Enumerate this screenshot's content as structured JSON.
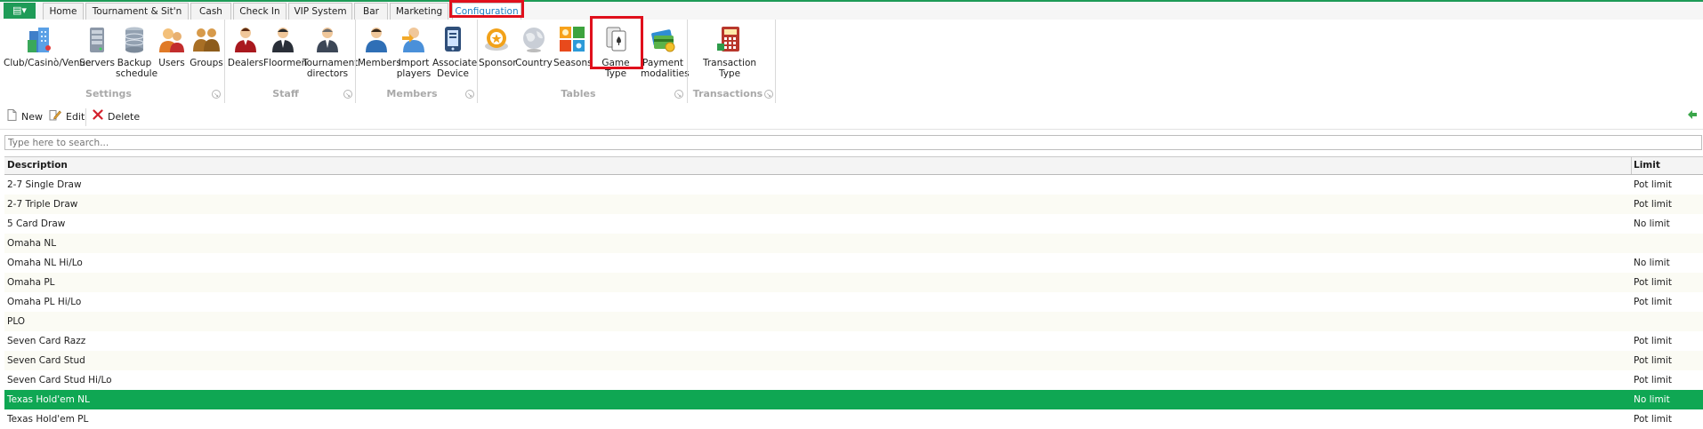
{
  "tabs": [
    {
      "label": "Home"
    },
    {
      "label": "Tournament & Sit'n Go"
    },
    {
      "label": "Cash"
    },
    {
      "label": "Check In"
    },
    {
      "label": "VIP System"
    },
    {
      "label": "Bar"
    },
    {
      "label": "Marketing"
    },
    {
      "label": "Configuration"
    }
  ],
  "ribbon": {
    "buttons": [
      {
        "label": "Club/Casinò/Venue",
        "icon": "building-icon"
      },
      {
        "label": "Servers",
        "icon": "server-icon"
      },
      {
        "label": "Backup\nschedule",
        "icon": "database-icon"
      },
      {
        "label": "Users",
        "icon": "users-icon"
      },
      {
        "label": "Groups",
        "icon": "groups-icon"
      },
      {
        "label": "Dealers",
        "icon": "dealer-icon"
      },
      {
        "label": "Floormen",
        "icon": "floorman-icon"
      },
      {
        "label": "Tournament\ndirectors",
        "icon": "director-icon"
      },
      {
        "label": "Members",
        "icon": "member-icon"
      },
      {
        "label": "Import\nplayers",
        "icon": "import-players-icon"
      },
      {
        "label": "Associate\nDevice",
        "icon": "device-icon"
      },
      {
        "label": "Sponsor",
        "icon": "sponsor-icon"
      },
      {
        "label": "Country",
        "icon": "globe-icon"
      },
      {
        "label": "Seasons",
        "icon": "seasons-icon"
      },
      {
        "label": "Game Type",
        "icon": "game-type-icon"
      },
      {
        "label": "Payment\nmodalities",
        "icon": "payment-icon"
      },
      {
        "label": "Transaction\nType",
        "icon": "calculator-icon"
      }
    ],
    "groups": [
      {
        "label": "Settings"
      },
      {
        "label": "Staff"
      },
      {
        "label": "Members"
      },
      {
        "label": "Tables"
      },
      {
        "label": "Transactions"
      }
    ]
  },
  "toolbar": {
    "new_label": "New",
    "edit_label": "Edit",
    "delete_label": "Delete"
  },
  "search": {
    "placeholder": "Type here to search..."
  },
  "grid": {
    "columns": [
      "Description",
      "Limit"
    ],
    "rows": [
      {
        "description": "2-7 Single Draw",
        "limit": "Pot limit"
      },
      {
        "description": "2-7 Triple Draw",
        "limit": "Pot limit"
      },
      {
        "description": "5 Card Draw",
        "limit": "No limit"
      },
      {
        "description": "Omaha NL",
        "limit": ""
      },
      {
        "description": "Omaha NL Hi/Lo",
        "limit": "No limit"
      },
      {
        "description": "Omaha PL",
        "limit": "Pot limit"
      },
      {
        "description": "Omaha PL Hi/Lo",
        "limit": "Pot limit"
      },
      {
        "description": "PLO",
        "limit": ""
      },
      {
        "description": "Seven Card Razz",
        "limit": "Pot limit"
      },
      {
        "description": "Seven Card Stud",
        "limit": "Pot limit"
      },
      {
        "description": "Seven Card Stud Hi/Lo",
        "limit": "Pot limit"
      },
      {
        "description": "Texas Hold'em NL",
        "limit": "No limit"
      },
      {
        "description": "Texas Hold'em PL",
        "limit": "Pot limit"
      }
    ],
    "selected_row": "Texas Hold'em NL"
  },
  "colors": {
    "accent": "#1e9b57",
    "selected_row": "#0fa753",
    "highlight_box": "#e0101c",
    "active_tab_text": "#1b7fc4"
  }
}
